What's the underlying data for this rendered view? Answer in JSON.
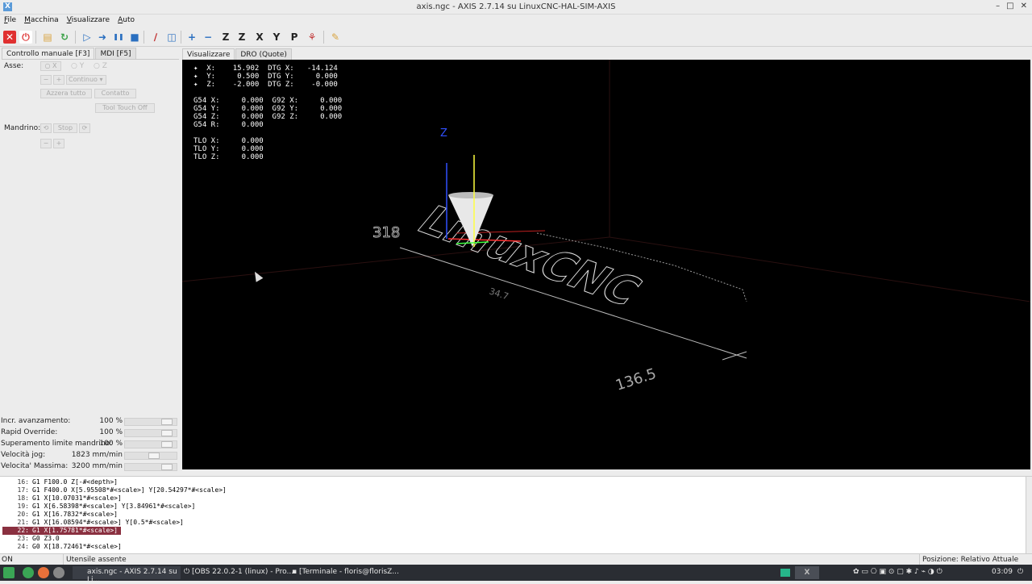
{
  "window": {
    "title": "axis.ngc - AXIS 2.7.14 su LinuxCNC-HAL-SIM-AXIS",
    "controls": [
      "–",
      "□",
      "✕"
    ]
  },
  "menu": {
    "items": [
      {
        "first": "F",
        "rest": "ile"
      },
      {
        "first": "M",
        "rest": "acchina"
      },
      {
        "first": "V",
        "rest": "isualizzare"
      },
      {
        "first": "A",
        "rest": "uto"
      }
    ]
  },
  "toolbar": {
    "items": [
      {
        "name": "estop-icon",
        "glyph": "✕",
        "color": "#e03030",
        "bg": "#e03030",
        "fg": "#fff"
      },
      {
        "name": "power-icon",
        "glyph": "⏻",
        "color": "#ffffff",
        "bg": "#ffffff",
        "fg": "#e04040"
      },
      {
        "name": "open-file-icon",
        "glyph": "▤",
        "color": "#d9a441",
        "bg": "transparent",
        "fg": "#d9a441"
      },
      {
        "name": "reload-icon",
        "glyph": "↻",
        "color": "#3da34a",
        "bg": "transparent",
        "fg": "#3da34a"
      },
      {
        "name": "run-icon",
        "glyph": "▷",
        "color": "#2a6fc0",
        "bg": "transparent",
        "fg": "#2a6fc0"
      },
      {
        "name": "step-icon",
        "glyph": "➜",
        "color": "#2a6fc0",
        "bg": "transparent",
        "fg": "#2a6fc0"
      },
      {
        "name": "pause-icon",
        "glyph": "❚❚",
        "color": "#2a6fc0",
        "bg": "transparent",
        "fg": "#2a6fc0"
      },
      {
        "name": "stop-icon",
        "glyph": "■",
        "color": "#2a6fc0",
        "bg": "transparent",
        "fg": "#2a6fc0"
      },
      {
        "name": "block-delete-icon",
        "glyph": "∕",
        "color": "#c03030",
        "bg": "transparent",
        "fg": "#c03030"
      },
      {
        "name": "optional-stop-icon",
        "glyph": "◫",
        "color": "#2a6fc0",
        "bg": "transparent",
        "fg": "#2a6fc0"
      },
      {
        "name": "zoom-in-icon",
        "glyph": "+",
        "color": "#2a6fc0",
        "bg": "transparent",
        "fg": "#2a6fc0"
      },
      {
        "name": "zoom-out-icon",
        "glyph": "−",
        "color": "#2a6fc0",
        "bg": "transparent",
        "fg": "#2a6fc0"
      },
      {
        "name": "view-z-icon",
        "glyph": "Z",
        "color": "#222",
        "bg": "transparent",
        "fg": "#222"
      },
      {
        "name": "view-z2-icon",
        "glyph": "Z",
        "color": "#222",
        "bg": "transparent",
        "fg": "#222"
      },
      {
        "name": "view-x-icon",
        "glyph": "X",
        "color": "#222",
        "bg": "transparent",
        "fg": "#222"
      },
      {
        "name": "view-y-icon",
        "glyph": "Y",
        "color": "#222",
        "bg": "transparent",
        "fg": "#222"
      },
      {
        "name": "view-p-icon",
        "glyph": "P",
        "color": "#222",
        "bg": "transparent",
        "fg": "#222"
      },
      {
        "name": "rotate-icon",
        "glyph": "⚘",
        "color": "#c03030",
        "bg": "transparent",
        "fg": "#c03030"
      },
      {
        "name": "clear-plot-icon",
        "glyph": "✎",
        "color": "#d9a441",
        "bg": "transparent",
        "fg": "#d9a441"
      }
    ]
  },
  "left": {
    "tabs": [
      "Controllo manuale [F3]",
      "MDI [F5]"
    ],
    "axis_label": "Asse:",
    "axes": [
      "X",
      "Y",
      "Z"
    ],
    "jog_minus": "−",
    "jog_plus": "+",
    "jog_mode": "Continuo",
    "zero_all": "Azzera tutto",
    "touch": "Contatto",
    "tool_touch_off": "Tool Touch Off",
    "spindle_label": "Mandrino:",
    "spindle_stop": "Stop",
    "spindle_minus": "−",
    "spindle_plus": "+",
    "sliders": [
      {
        "label": "Incr. avanzamento:",
        "value": "100 %",
        "fraction": 0.9
      },
      {
        "label": "Rapid Override:",
        "value": "100 %",
        "fraction": 0.9
      },
      {
        "label": "Superamento limite mandrino:",
        "value": "100 %",
        "fraction": 0.9
      },
      {
        "label": "Velocità jog:",
        "value": "1823 mm/min",
        "fraction": 0.58
      },
      {
        "label": "Velocita' Massima:",
        "value": "3200 mm/min",
        "fraction": 0.9
      }
    ]
  },
  "viewtabs": [
    "Visualizzare",
    "DRO (Quote)"
  ],
  "dro": [
    "✦  X:    15.902  DTG X:   -14.124",
    "✦  Y:     0.500  DTG Y:     0.000",
    "✦  Z:    -2.000  DTG Z:    -0.000",
    "",
    "G54 X:     0.000  G92 X:     0.000",
    "G54 Y:     0.000  G92 Y:     0.000",
    "G54 Z:     0.000  G92 Z:     0.000",
    "G54 R:     0.000",
    "",
    "TLO X:     0.000",
    "TLO Y:     0.000",
    "TLO Z:     0.000"
  ],
  "plot": {
    "axis_label_z": "Z",
    "extent_label": "136.5",
    "extent_label_small": "34.7",
    "path_text": "LinuxCNC",
    "colors": {
      "background": "#000000",
      "z_axis": "#3050ff",
      "cone": "#e8e8e8",
      "tool_y": "#ffff40",
      "x_axis": "#ff3030",
      "path": "#ffffff"
    }
  },
  "gcode": [
    {
      "n": "16:",
      "code": "G1 F100.0 Z[-#<depth>]"
    },
    {
      "n": "17:",
      "code": "G1 F400.0 X[5.95508*#<scale>] Y[20.54297*#<scale>]"
    },
    {
      "n": "18:",
      "code": "G1 X[10.07031*#<scale>]"
    },
    {
      "n": "19:",
      "code": "G1 X[6.58398*#<scale>] Y[3.84961*#<scale>]"
    },
    {
      "n": "20:",
      "code": "G1 X[16.7832*#<scale>]"
    },
    {
      "n": "21:",
      "code": "G1 X[16.08594*#<scale>] Y[0.5*#<scale>]"
    },
    {
      "n": "22:",
      "code": "G1 X[1.75781*#<scale>]",
      "highlight": true
    },
    {
      "n": "23:",
      "code": "G0 Z3.0"
    },
    {
      "n": "24:",
      "code": "G0 X[18.72461*#<scale>]"
    }
  ],
  "status": {
    "state": "ON",
    "tool": "Utensile assente",
    "position": "Posizione: Relativo Attuale"
  },
  "taskbar": {
    "tasks": [
      "axis.ngc - AXIS 2.7.14 su Li...",
      "[OBS 22.0.2-1 (linux) - Pro...",
      "[Terminale - floris@florisZ..."
    ],
    "clock": "03:09"
  }
}
